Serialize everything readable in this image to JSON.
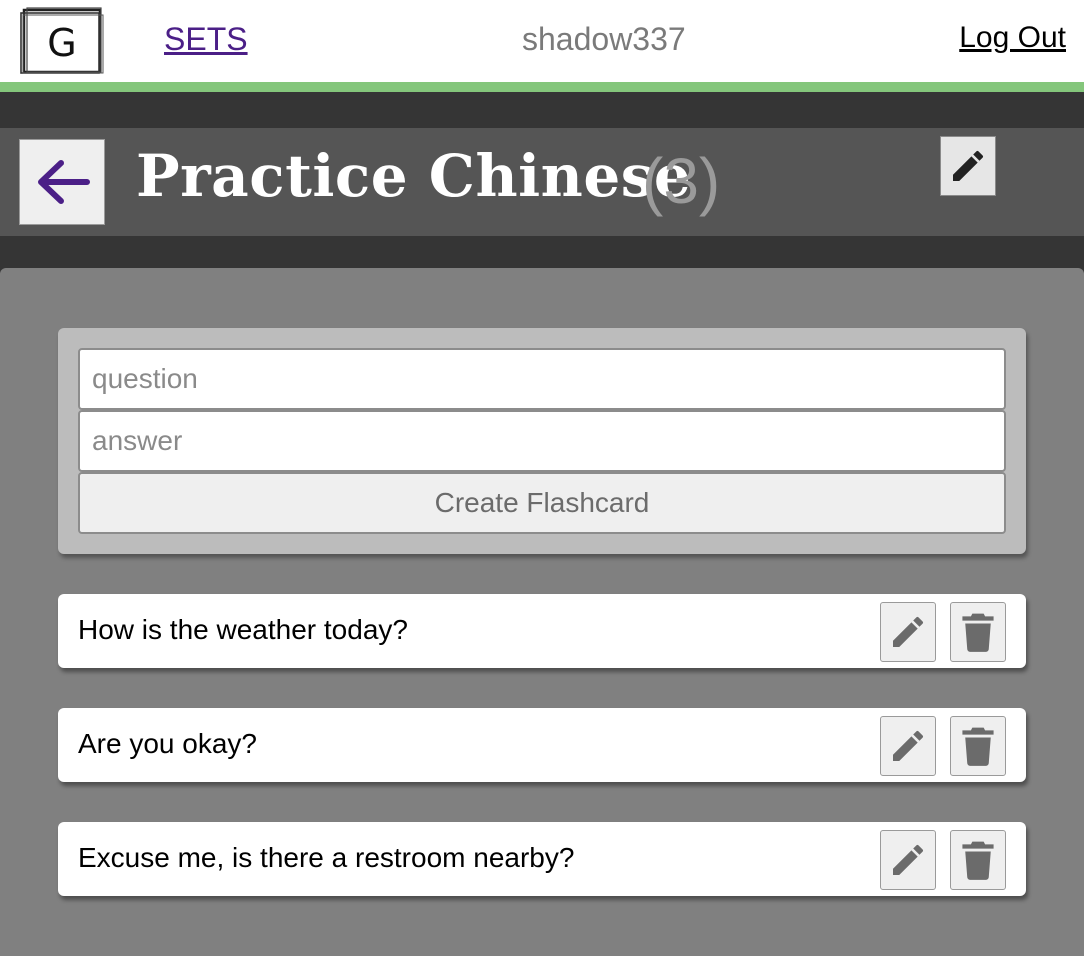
{
  "nav": {
    "logo_letter": "G",
    "sets_label": "SETS",
    "username": "shadow337",
    "logout_label": "Log Out"
  },
  "set": {
    "title": "Practice Chinese",
    "count": "(3)"
  },
  "create": {
    "question_placeholder": "question",
    "answer_placeholder": "answer",
    "button_label": "Create Flashcard"
  },
  "cards": [
    {
      "question": "How is the weather today?"
    },
    {
      "question": "Are you okay?"
    },
    {
      "question": "Excuse me, is there a restroom nearby?"
    }
  ],
  "colors": {
    "accent_green": "#84c67b",
    "link_purple": "#4b1f87",
    "icon_gray": "#6b6b6b"
  }
}
